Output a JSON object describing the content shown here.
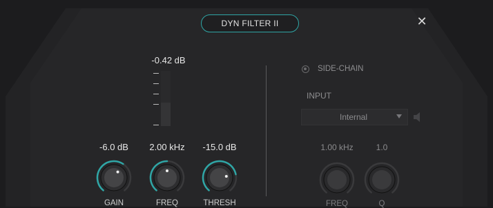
{
  "plugin": {
    "title": "DYN FILTER II",
    "close_icon": "close-icon"
  },
  "meter": {
    "value": "-0.42 dB",
    "level": 0.42
  },
  "knobs": [
    {
      "id": "gain",
      "value": "-6.0 dB",
      "label": "GAIN",
      "position": 0.62,
      "enabled": true
    },
    {
      "id": "freq",
      "value": "2.00 kHz",
      "label": "FREQ",
      "position": 0.5,
      "enabled": true
    },
    {
      "id": "thresh",
      "value": "-15.0 dB",
      "label": "THRESH",
      "position": 0.78,
      "enabled": true
    }
  ],
  "sidechain": {
    "label": "SIDE-CHAIN",
    "input_label": "INPUT",
    "input_value": "Internal",
    "knobs": [
      {
        "id": "sc-freq",
        "value": "1.00 kHz",
        "label": "FREQ",
        "enabled": false
      },
      {
        "id": "sc-q",
        "value": "1.0",
        "label": "Q",
        "enabled": false
      }
    ]
  },
  "colors": {
    "accent": "#2fa6a6",
    "background": "#1c1c1e",
    "panel": "#252527"
  }
}
